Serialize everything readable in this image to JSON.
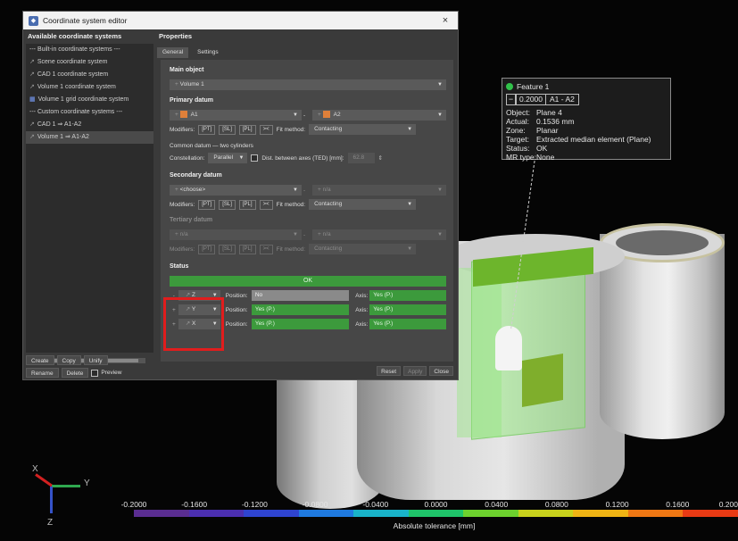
{
  "dialog": {
    "title": "Coordinate system editor",
    "close_glyph": "×",
    "left_header": "Available coordinate systems",
    "tree": [
      {
        "label": "--- Built-in coordinate systems ---",
        "icon": "none"
      },
      {
        "label": "Scene coordinate system",
        "icon": "axes-icon"
      },
      {
        "label": "CAD 1 coordinate system",
        "icon": "axes-icon"
      },
      {
        "label": "Volume 1 coordinate system",
        "icon": "axes-icon"
      },
      {
        "label": "Volume 1 grid coordinate system",
        "icon": "grid-icon"
      },
      {
        "label": "--- Custom coordinate systems ---",
        "icon": "none"
      },
      {
        "label": "CAD 1 ⇒ A1-A2",
        "icon": "axes-icon"
      },
      {
        "label": "Volume 1 ⇒ A1-A2",
        "icon": "axes-icon",
        "selected": true
      }
    ],
    "left_buttons": {
      "create": "Create",
      "copy": "Copy",
      "unify": "Unify",
      "rename": "Rename",
      "delete": "Delete",
      "preview": "Preview"
    },
    "right_header": "Properties",
    "tabs": [
      "General",
      "Settings"
    ],
    "main_object": {
      "header": "Main object",
      "value": "Volume 1"
    },
    "primary_datum": {
      "header": "Primary datum",
      "a": "A1",
      "b": "A2",
      "separator": "-",
      "modifiers_label": "Modifiers:",
      "modifiers": [
        "[PT]",
        "[SL]",
        "[PL]",
        "><"
      ],
      "fit_label": "Fit method:",
      "fit_value": "Contacting"
    },
    "common_datum": {
      "header": "Common datum — two cylinders",
      "constellation_label": "Constellation:",
      "constellation_value": "Parallel",
      "dist_label": "Dist. between axes (TED) [mm]:",
      "dist_value": "62.8"
    },
    "secondary_datum": {
      "header": "Secondary datum",
      "a": "<choose>",
      "b": "n/a",
      "separator": "-",
      "modifiers_label": "Modifiers:",
      "modifiers": [
        "[PT]",
        "[SL]",
        "[PL]",
        "><"
      ],
      "fit_label": "Fit method:",
      "fit_value": "Contacting"
    },
    "tertiary_datum": {
      "header": "Tertiary datum",
      "a": "n/a",
      "b": "n/a",
      "separator": "-",
      "modifiers_label": "Modifiers:",
      "modifiers": [
        "[PT]",
        "[SL]",
        "[PL]",
        "><"
      ],
      "fit_label": "Fit method:",
      "fit_value": "Contacting"
    },
    "status": {
      "header": "Status",
      "value": "OK",
      "rows": [
        {
          "sign": "-",
          "axis": "Z",
          "position_label": "Position:",
          "position": "No",
          "position_ok": false,
          "axis_label": "Axis:",
          "axis_value": "Yes (P.)"
        },
        {
          "sign": "+",
          "axis": "Y",
          "position_label": "Position:",
          "position": "Yes (P.)",
          "position_ok": true,
          "axis_label": "Axis:",
          "axis_value": "Yes (P.)"
        },
        {
          "sign": "+",
          "axis": "X",
          "position_label": "Position:",
          "position": "Yes (P.)",
          "position_ok": true,
          "axis_label": "Axis:",
          "axis_value": "Yes (P.)"
        }
      ]
    },
    "bottom_buttons": {
      "reset": "Reset",
      "apply": "Apply",
      "close": "Close"
    }
  },
  "feature": {
    "title": "Feature 1",
    "minus": "−",
    "nominal": "0.2000",
    "reference": "A1 - A2",
    "rows": [
      {
        "key": "Object:",
        "value": "Plane 4"
      },
      {
        "key": "Actual:",
        "value": "0.1536 mm"
      },
      {
        "key": "Zone:",
        "value": "Planar"
      },
      {
        "key": "Target:",
        "value": "Extracted median element (Plane)"
      },
      {
        "key": "Status:",
        "value": "OK"
      },
      {
        "key": "MR type:",
        "value": "None"
      }
    ]
  },
  "colorbar": {
    "ticks": [
      "-0.2000",
      "-0.1600",
      "-0.1200",
      "-0.0800",
      "-0.0400",
      "0.0000",
      "0.0400",
      "0.0800",
      "0.1200",
      "0.1600",
      "0.200"
    ],
    "label": "Absolute tolerance [mm]",
    "colors": [
      "#5a2d91",
      "#4b2fb0",
      "#2f44d0",
      "#1f7ae0",
      "#19b3c9",
      "#1fc46a",
      "#6dd12e",
      "#c8d21c",
      "#f0b414",
      "#f07814",
      "#e83a14"
    ]
  },
  "triad": {
    "x": "X",
    "y": "Y",
    "z": "Z"
  }
}
